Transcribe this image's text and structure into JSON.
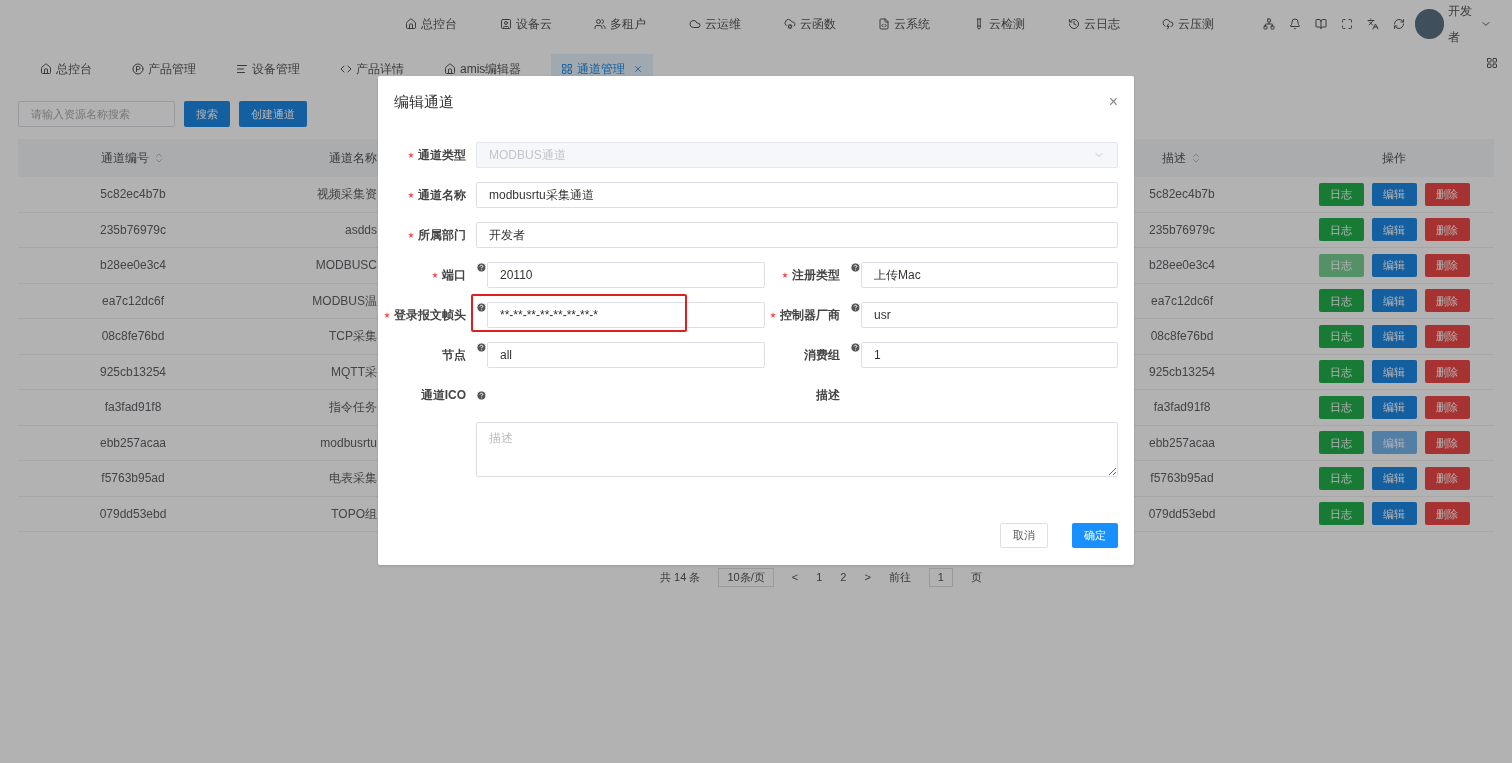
{
  "top_nav": {
    "items": [
      {
        "label": "总控台"
      },
      {
        "label": "设备云"
      },
      {
        "label": "多租户"
      },
      {
        "label": "云运维"
      },
      {
        "label": "云函数"
      },
      {
        "label": "云系统"
      },
      {
        "label": "云检测"
      },
      {
        "label": "云日志"
      },
      {
        "label": "云压测"
      }
    ],
    "user": {
      "name": "开发者"
    }
  },
  "tabs": [
    {
      "label": "总控台",
      "selected": false,
      "closable": false
    },
    {
      "label": "产品管理",
      "selected": false,
      "closable": false
    },
    {
      "label": "设备管理",
      "selected": false,
      "closable": false
    },
    {
      "label": "产品详情",
      "selected": false,
      "closable": false
    },
    {
      "label": "amis编辑器",
      "selected": false,
      "closable": false
    },
    {
      "label": "通道管理",
      "selected": true,
      "closable": true
    }
  ],
  "search": {
    "placeholder": "请输入资源名称搜索",
    "buttons": [
      "搜索",
      "创建通道"
    ]
  },
  "table": {
    "columns": [
      {
        "label": "通道编号",
        "sortable": true
      },
      {
        "label": "通道名称",
        "sortable": false
      },
      {
        "label": "描述",
        "sortable": true
      },
      {
        "label": "操作",
        "sortable": false
      }
    ],
    "rows": [
      {
        "id": "5c82ec4b7b",
        "name": "视频采集资",
        "description": "5c82ec4b7b",
        "actions": [
          {
            "label": "日志",
            "kind": "log",
            "faded": false
          },
          {
            "label": "编辑",
            "kind": "edit",
            "faded": false
          },
          {
            "label": "删除",
            "kind": "delete",
            "faded": false
          }
        ]
      },
      {
        "id": "235b76979c",
        "name": "asdds",
        "description": "235b76979c",
        "actions": [
          {
            "label": "日志",
            "kind": "log",
            "faded": false
          },
          {
            "label": "编辑",
            "kind": "edit",
            "faded": false
          },
          {
            "label": "删除",
            "kind": "delete",
            "faded": false
          }
        ]
      },
      {
        "id": "b28ee0e3c4",
        "name": "MODBUSC",
        "description": "b28ee0e3c4",
        "actions": [
          {
            "label": "日志",
            "kind": "log",
            "faded": true
          },
          {
            "label": "编辑",
            "kind": "edit",
            "faded": false
          },
          {
            "label": "删除",
            "kind": "delete",
            "faded": false
          }
        ]
      },
      {
        "id": "ea7c12dc6f",
        "name": "MODBUS温",
        "description": "ea7c12dc6f",
        "actions": [
          {
            "label": "日志",
            "kind": "log",
            "faded": false
          },
          {
            "label": "编辑",
            "kind": "edit",
            "faded": false
          },
          {
            "label": "删除",
            "kind": "delete",
            "faded": false
          }
        ]
      },
      {
        "id": "08c8fe76bd",
        "name": "TCP采集",
        "description": "08c8fe76bd",
        "actions": [
          {
            "label": "日志",
            "kind": "log",
            "faded": false
          },
          {
            "label": "编辑",
            "kind": "edit",
            "faded": false
          },
          {
            "label": "删除",
            "kind": "delete",
            "faded": false
          }
        ]
      },
      {
        "id": "925cb13254",
        "name": "MQTT采",
        "description": "925cb13254",
        "actions": [
          {
            "label": "日志",
            "kind": "log",
            "faded": false
          },
          {
            "label": "编辑",
            "kind": "edit",
            "faded": false
          },
          {
            "label": "删除",
            "kind": "delete",
            "faded": false
          }
        ]
      },
      {
        "id": "fa3fad91f8",
        "name": "指令任务",
        "description": "fa3fad91f8",
        "actions": [
          {
            "label": "日志",
            "kind": "log",
            "faded": false
          },
          {
            "label": "编辑",
            "kind": "edit",
            "faded": false
          },
          {
            "label": "删除",
            "kind": "delete",
            "faded": false
          }
        ]
      },
      {
        "id": "ebb257acaa",
        "name": "modbusrtu",
        "description": "ebb257acaa",
        "actions": [
          {
            "label": "日志",
            "kind": "log",
            "faded": false
          },
          {
            "label": "编辑",
            "kind": "edit",
            "faded": true
          },
          {
            "label": "删除",
            "kind": "delete",
            "faded": false
          }
        ]
      },
      {
        "id": "f5763b95ad",
        "name": "电表采集",
        "description": "f5763b95ad",
        "actions": [
          {
            "label": "日志",
            "kind": "log",
            "faded": false
          },
          {
            "label": "编辑",
            "kind": "edit",
            "faded": false
          },
          {
            "label": "删除",
            "kind": "delete",
            "faded": false
          }
        ]
      },
      {
        "id": "079dd53ebd",
        "name": "TOPO组",
        "description": "079dd53ebd",
        "actions": [
          {
            "label": "日志",
            "kind": "log",
            "faded": false
          },
          {
            "label": "编辑",
            "kind": "edit",
            "faded": false
          },
          {
            "label": "删除",
            "kind": "delete",
            "faded": false
          }
        ]
      }
    ]
  },
  "pagination": {
    "total": "共 14 条",
    "page_size": "10条/页",
    "prev": "<",
    "pages": [
      "1",
      "2"
    ],
    "next": ">",
    "goto_label": "前往",
    "goto_value": "1",
    "goto_suffix": "页"
  },
  "dialog": {
    "title": "编辑通道",
    "close": "×",
    "rows": [
      {
        "fields": [
          {
            "kind": "select",
            "label": "通道类型",
            "value": "MODBUS通道",
            "required": true,
            "help": false,
            "disabled": true,
            "highlighted": false
          }
        ]
      },
      {
        "fields": [
          {
            "kind": "input",
            "label": "通道名称",
            "value": "modbusrtu采集通道",
            "required": true,
            "help": false,
            "disabled": false,
            "highlighted": false
          }
        ]
      },
      {
        "fields": [
          {
            "kind": "input",
            "label": "所属部门",
            "value": "开发者",
            "required": true,
            "help": false,
            "disabled": false,
            "highlighted": false
          }
        ]
      },
      {
        "fields": [
          {
            "kind": "input",
            "label": "端口",
            "value": "20110",
            "required": true,
            "help": true,
            "disabled": false,
            "highlighted": false
          },
          {
            "kind": "input",
            "label": "注册类型",
            "value": "上传Mac",
            "required": true,
            "help": true,
            "disabled": false,
            "highlighted": false
          }
        ]
      },
      {
        "fields": [
          {
            "kind": "input",
            "label": "登录报文帧头",
            "value": "**-**-**-**-**-**-**-*",
            "required": true,
            "help": true,
            "disabled": false,
            "highlighted": true
          },
          {
            "kind": "input",
            "label": "控制器厂商",
            "value": "usr",
            "required": true,
            "help": true,
            "disabled": false,
            "highlighted": false
          }
        ]
      },
      {
        "fields": [
          {
            "kind": "input",
            "label": "节点",
            "value": "all",
            "required": false,
            "help": true,
            "disabled": false,
            "highlighted": false
          },
          {
            "kind": "input",
            "label": "消费组",
            "value": "1",
            "required": false,
            "help": true,
            "disabled": false,
            "highlighted": false
          }
        ]
      },
      {
        "fields": [
          {
            "kind": "empty",
            "label": "通道ICO",
            "required": false,
            "help": true
          },
          {
            "kind": "empty",
            "label": "描述",
            "required": false,
            "help": false
          }
        ]
      },
      {
        "fields": [
          {
            "kind": "textarea",
            "placeholder": "描述"
          }
        ]
      }
    ],
    "buttons": [
      {
        "label": "取消",
        "kind": "secondary"
      },
      {
        "label": "确定",
        "kind": "primary"
      }
    ]
  }
}
